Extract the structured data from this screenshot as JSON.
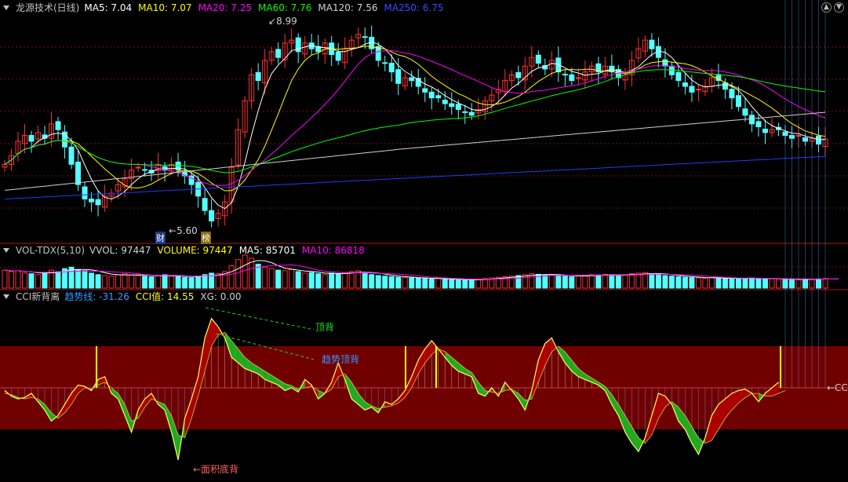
{
  "colors": {
    "bg": "#000000",
    "up": "#ff3232",
    "down": "#54ffff",
    "grid": "#7a1010",
    "ma5": "#ffffff",
    "ma10": "#ffff00",
    "ma20": "#ff00ff",
    "ma60": "#00ff00",
    "ma120": "#d0d0d0",
    "ma250": "#1e3cff",
    "band": "#700000",
    "cci": "#ffff55",
    "green": "#22aa22",
    "red": "#aa0000",
    "dash": "#22cc22"
  },
  "price_panel": {
    "title": "龙源技术(日线)",
    "indicators": [
      {
        "label": "MA5: 7.04",
        "color": "#ffffff"
      },
      {
        "label": "MA10: 7.07",
        "color": "#ffff00"
      },
      {
        "label": "MA20: 7.25",
        "color": "#ff00ff"
      },
      {
        "label": "MA60: 7.76",
        "color": "#00ff00"
      },
      {
        "label": "MA120: 7.56",
        "color": "#d0d0d0"
      },
      {
        "label": "MA250: 6.75",
        "color": "#3050ff"
      }
    ],
    "high_label": "8.99",
    "low_label": "5.60",
    "event_badges": [
      "财",
      "榜"
    ],
    "controls": [
      "chevron-up-icon",
      "chevron-down-icon"
    ]
  },
  "volume_panel": {
    "title": "VOL-TDX(5,10)",
    "indicators": [
      {
        "label": "VVOL: 97447",
        "color": "#d0d0d0"
      },
      {
        "label": "VOLUME: 97447",
        "color": "#ffff00"
      },
      {
        "label": "MA5: 85701",
        "color": "#ffffff"
      },
      {
        "label": "MA10: 86818",
        "color": "#ff00ff"
      }
    ]
  },
  "cci_panel": {
    "title": "CCI新背离",
    "indicators": [
      {
        "label": "趋势线: -31.26",
        "color": "#3399ff"
      },
      {
        "label": "CCI值: 14.55",
        "color": "#ffff00"
      },
      {
        "label": "XG: 0.00",
        "color": "#d0d0d0"
      }
    ],
    "annotations": {
      "top_divergence": "顶背",
      "trend_top_divergence": "趋势顶背",
      "area_bottom_divergence": "←面积底背",
      "right_edge": "←CC"
    }
  },
  "chart_data": {
    "type": "candlestick",
    "ylim": [
      5.3,
      9.2
    ],
    "closes": [
      6.6,
      6.75,
      7.0,
      7.1,
      7.0,
      7.15,
      7.05,
      7.3,
      7.2,
      6.9,
      6.6,
      6.25,
      6.0,
      5.95,
      5.9,
      6.05,
      6.1,
      6.25,
      6.35,
      6.5,
      6.55,
      6.5,
      6.45,
      6.6,
      6.5,
      6.6,
      6.5,
      6.4,
      6.25,
      6.05,
      5.8,
      5.62,
      5.75,
      5.95,
      6.55,
      7.2,
      7.7,
      8.15,
      8.05,
      8.4,
      8.55,
      8.45,
      8.7,
      8.75,
      8.55,
      8.7,
      8.6,
      8.55,
      8.7,
      8.5,
      8.4,
      8.6,
      8.75,
      8.85,
      8.8,
      8.6,
      8.4,
      8.35,
      8.2,
      8.0,
      8.1,
      8.05,
      7.95,
      7.85,
      7.75,
      7.75,
      7.65,
      7.6,
      7.55,
      7.5,
      7.45,
      7.55,
      7.7,
      7.8,
      7.9,
      8.05,
      8.15,
      8.1,
      8.3,
      8.45,
      8.35,
      8.25,
      8.4,
      8.2,
      8.15,
      8.05,
      8.1,
      8.2,
      8.3,
      8.2,
      8.3,
      8.2,
      8.1,
      8.15,
      8.4,
      8.6,
      8.75,
      8.6,
      8.45,
      8.3,
      8.15,
      8.05,
      7.95,
      7.85,
      7.9,
      7.95,
      8.1,
      8.05,
      7.9,
      7.75,
      7.6,
      7.45,
      7.3,
      7.25,
      7.15,
      7.2,
      7.2,
      7.1,
      7.05,
      7.1,
      7.0,
      7.05,
      6.95,
      7.04
    ],
    "volumes": [
      60,
      55,
      58,
      50,
      48,
      45,
      52,
      60,
      55,
      65,
      70,
      62,
      58,
      50,
      45,
      42,
      40,
      45,
      48,
      44,
      42,
      40,
      38,
      42,
      45,
      40,
      38,
      36,
      35,
      40,
      45,
      50,
      48,
      55,
      75,
      95,
      110,
      100,
      80,
      70,
      65,
      60,
      58,
      62,
      55,
      50,
      52,
      48,
      45,
      50,
      48,
      52,
      55,
      58,
      50,
      45,
      42,
      40,
      38,
      36,
      35,
      34,
      33,
      32,
      30,
      32,
      30,
      28,
      27,
      26,
      28,
      30,
      32,
      34,
      36,
      38,
      40,
      42,
      45,
      48,
      46,
      44,
      45,
      42,
      40,
      38,
      40,
      42,
      45,
      44,
      46,
      44,
      42,
      44,
      48,
      50,
      52,
      48,
      45,
      42,
      40,
      38,
      36,
      35,
      34,
      33,
      35,
      34,
      32,
      30,
      32,
      33,
      34,
      32,
      30,
      31,
      30,
      29,
      30,
      28,
      29,
      30,
      31,
      32,
      30,
      32
    ],
    "cci": [
      -10,
      -30,
      -40,
      -35,
      -20,
      -50,
      -80,
      -120,
      -100,
      -60,
      -20,
      10,
      5,
      -10,
      30,
      40,
      -20,
      -40,
      -100,
      -160,
      -80,
      -40,
      -20,
      -60,
      -80,
      -160,
      -260,
      -110,
      -40,
      40,
      180,
      250,
      220,
      180,
      110,
      90,
      70,
      60,
      50,
      30,
      20,
      10,
      -10,
      0,
      -15,
      30,
      10,
      -40,
      -20,
      20,
      90,
      30,
      -40,
      -60,
      -80,
      -70,
      -90,
      -50,
      -60,
      -40,
      -10,
      40,
      100,
      140,
      170,
      140,
      110,
      80,
      60,
      50,
      40,
      -20,
      -30,
      0,
      -30,
      20,
      -10,
      -40,
      -80,
      -10,
      100,
      160,
      180,
      130,
      90,
      60,
      40,
      30,
      20,
      10,
      -10,
      -60,
      -100,
      -160,
      -200,
      -230,
      -180,
      -100,
      -20,
      -30,
      -60,
      -120,
      -150,
      -200,
      -240,
      -180,
      -100,
      -60,
      -40,
      -20,
      -10,
      -5,
      -20,
      -50,
      -20,
      0,
      20
    ],
    "trend": [
      -20,
      -25,
      -35,
      -40,
      -35,
      -40,
      -60,
      -90,
      -110,
      -90,
      -60,
      -20,
      0,
      -5,
      10,
      20,
      0,
      -20,
      -60,
      -120,
      -110,
      -70,
      -40,
      -50,
      -60,
      -100,
      -170,
      -180,
      -110,
      -30,
      60,
      150,
      190,
      200,
      170,
      140,
      110,
      90,
      75,
      60,
      45,
      30,
      15,
      8,
      -5,
      0,
      5,
      -10,
      -20,
      -5,
      40,
      50,
      20,
      -20,
      -50,
      -65,
      -75,
      -70,
      -65,
      -55,
      -35,
      0,
      50,
      90,
      120,
      140,
      130,
      110,
      90,
      70,
      55,
      20,
      -10,
      -15,
      -20,
      -10,
      -5,
      -20,
      -45,
      -40,
      20,
      80,
      130,
      150,
      130,
      100,
      70,
      50,
      35,
      20,
      5,
      -25,
      -60,
      -100,
      -140,
      -180,
      -200,
      -170,
      -110,
      -70,
      -50,
      -70,
      -100,
      -140,
      -180,
      -200,
      -190,
      -150,
      -110,
      -80,
      -55,
      -35,
      -20,
      -20,
      -30,
      -30,
      -20,
      -10
    ],
    "cci_ylim": [
      -300,
      300
    ],
    "band": [
      -150,
      150
    ]
  }
}
